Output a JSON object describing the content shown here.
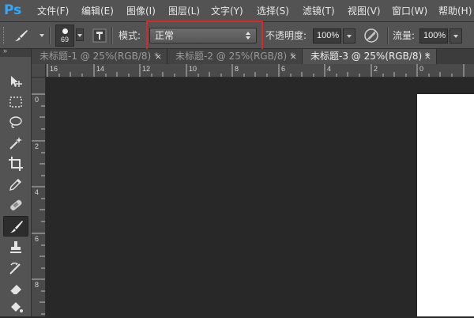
{
  "app": {
    "logo": "Ps"
  },
  "menu": {
    "items": [
      "文件(F)",
      "编辑(E)",
      "图像(I)",
      "图层(L)",
      "文字(Y)",
      "选择(S)",
      "滤镜(T)",
      "视图(V)",
      "窗口(W)",
      "帮助(H)"
    ]
  },
  "options": {
    "brush_size": "69",
    "mode_label": "模式:",
    "mode_value": "正常",
    "opacity_label": "不透明度:",
    "opacity_value": "100%",
    "flow_label": "流量:",
    "flow_value": "100%"
  },
  "tabs": [
    {
      "label": "未标题-1 @ 25%(RGB/8) *",
      "close": "×",
      "active": false
    },
    {
      "label": "未标题-2 @ 25%(RGB/8) *",
      "close": "×",
      "active": false
    },
    {
      "label": "未标题-3 @ 25%(RGB/8) *",
      "close": "×",
      "active": true
    }
  ],
  "toolbar": {
    "collapse": "»",
    "tools": [
      "move-tool-icon",
      "marquee-tool-icon",
      "lasso-tool-icon",
      "magic-wand-tool-icon",
      "crop-tool-icon",
      "eyedropper-tool-icon",
      "healing-brush-tool-icon",
      "brush-tool-icon",
      "clone-stamp-tool-icon",
      "history-brush-tool-icon",
      "eraser-tool-icon",
      "paint-bucket-tool-icon"
    ],
    "selected": "brush-tool-icon"
  },
  "rulers": {
    "horizontal": [
      "16",
      "14",
      "12",
      "10",
      "8",
      "6",
      "4",
      "2",
      "0"
    ],
    "vertical": [
      "0",
      "2",
      "4",
      "6",
      "8"
    ]
  },
  "colors": {
    "ui_gray": "#535353",
    "canvas_bg": "#282828",
    "highlight": "#d9272e",
    "document": "#ffffff",
    "logo": "#31a8ff"
  }
}
